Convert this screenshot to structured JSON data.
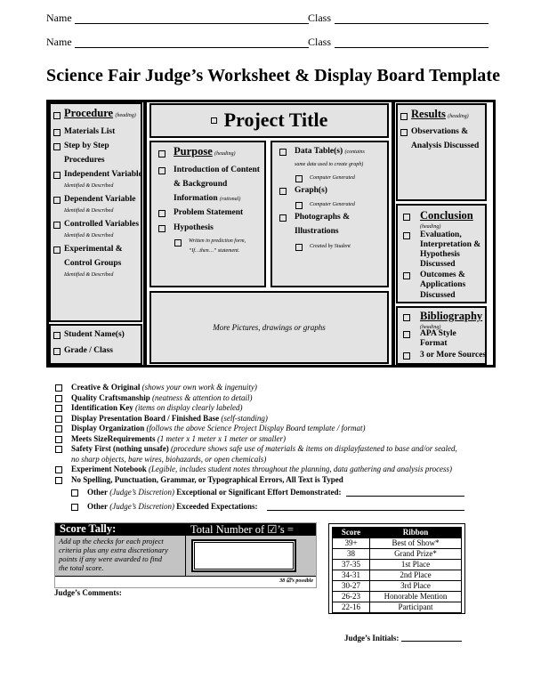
{
  "header": {
    "rows": [
      {
        "name_label": "Name",
        "class_label": "Class"
      },
      {
        "name_label": "Name",
        "class_label": "Class"
      }
    ],
    "title": "Science Fair Judge’s Worksheet & Display Board Template"
  },
  "board": {
    "procedure": {
      "heading": "Procedure",
      "heading_note": "(heading)",
      "items": [
        {
          "label": "Materials List"
        },
        {
          "label": "Step by Step",
          "label2": "Procedures"
        },
        {
          "label": "Independent Variable",
          "note": "Identified & Described"
        },
        {
          "label": "Dependent Variable",
          "note": "Identified & Described"
        },
        {
          "label": "Controlled Variables",
          "note": "Identified & Described"
        },
        {
          "label": "Experimental &",
          "label2": "Control Groups",
          "note": "Identified & Described"
        }
      ]
    },
    "student": {
      "items": [
        "Student Name(s)",
        "Grade / Class"
      ]
    },
    "project_title": "Project Title",
    "purpose": {
      "heading": "Purpose",
      "heading_note": "(heading)",
      "items": [
        {
          "label": "Introduction of Content",
          "label2": "& Background",
          "label3": "Information",
          "note": "(rational)"
        },
        {
          "label": "Problem Statement"
        },
        {
          "label": "Hypothesis"
        }
      ],
      "sub_item": {
        "line1": "Written in prediction form,",
        "line2": "“If…then…” statement."
      }
    },
    "data": {
      "items": [
        {
          "label": "Data Table(s)",
          "note": "(contains",
          "note2": "same data used to create graph)",
          "sub": "Computer Generated"
        },
        {
          "label": "Graph(s)",
          "sub": "Computer Generated"
        },
        {
          "label": "Photographs &",
          "label2": "Illustrations",
          "sub": "Created by Student"
        }
      ]
    },
    "pictures": "More Pictures, drawings or graphs",
    "results": {
      "heading": "Results",
      "heading_note": "(heading)",
      "items": [
        {
          "label": "Observations &",
          "label2": "Analysis Discussed"
        }
      ]
    },
    "conclusion": {
      "heading": "Conclusion",
      "heading_note": "(heading)",
      "items": [
        {
          "lines": [
            "Evaluation,",
            "Interpretation &",
            "Hypothesis",
            "Discussed"
          ]
        },
        {
          "lines": [
            "Outcomes &",
            "Applications",
            "Discussed"
          ]
        }
      ]
    },
    "bibliography": {
      "heading": "Bibliography",
      "heading_note": "(heading)",
      "items": [
        {
          "lines": [
            "APA Style",
            "Format"
          ]
        },
        {
          "lines": [
            "3 or More Sources"
          ]
        }
      ]
    }
  },
  "criteria": [
    {
      "bold": "Creative & Original",
      "italic": " (shows your own work & ingenuity)"
    },
    {
      "bold": "Quality Craftsmanship",
      "italic": " (neatness & attention to detail)"
    },
    {
      "bold": "Identification Key",
      "italic": " (items on display clearly labeled)"
    },
    {
      "bold": "Display Presentation Board / Finished Base",
      "italic": " (self-standing)"
    },
    {
      "bold": "Display Organization",
      "italic": " (follows the above Science Project Display Board template / format)"
    },
    {
      "bold": "Meets SizeRequirements",
      "italic": " (1 meter x 1 meter x 1 meter or smaller)"
    },
    {
      "bold": "Safety First (nothing unsafe)",
      "italic": " (procedure shows safe use of materials & items on displayfastened to base and/or sealed,",
      "italic2": "no sharp objects, bare wires, biohazards, or open chemicals)"
    },
    {
      "bold": "Experiment Notebook",
      "italic": " (Legible, includes student notes throughout the planning, data gathering and analysis process)"
    },
    {
      "bold": "No Spelling, Punctuation, Grammar, or Typographical Errors, All Text is Typed",
      "italic": ""
    }
  ],
  "other": [
    {
      "bold": "Other",
      "italic": " (Judge’s Discretion)",
      "bold2": " Exceptional or Significant Effort Demonstrated:"
    },
    {
      "bold": "Other",
      "italic": " (Judge’s Discretion)",
      "bold2": " Exceeded Expectations:"
    }
  ],
  "tally": {
    "title": "Score Tally:",
    "total_label": "Total Number of ☑’s =",
    "instructions": [
      "Add up the checks for each project",
      "criteria plus any extra discretionary",
      "points if any were awarded to find",
      "the total score."
    ],
    "possible": "38 ☑’s possible",
    "total_value": ""
  },
  "comments_label": "Judge’s Comments:",
  "ribbon_table": {
    "headers": [
      "Score",
      "Ribbon"
    ],
    "rows": [
      [
        "39+",
        "Best of Show*"
      ],
      [
        "38",
        "Grand Prize*"
      ],
      [
        "37-35",
        "1st Place"
      ],
      [
        "34-31",
        "2nd Place"
      ],
      [
        "30-27",
        "3rd Place"
      ],
      [
        "26-23",
        "Honorable Mention"
      ],
      [
        "22-16",
        "Participant"
      ]
    ]
  },
  "initials_label": "Judge’s Initials:"
}
